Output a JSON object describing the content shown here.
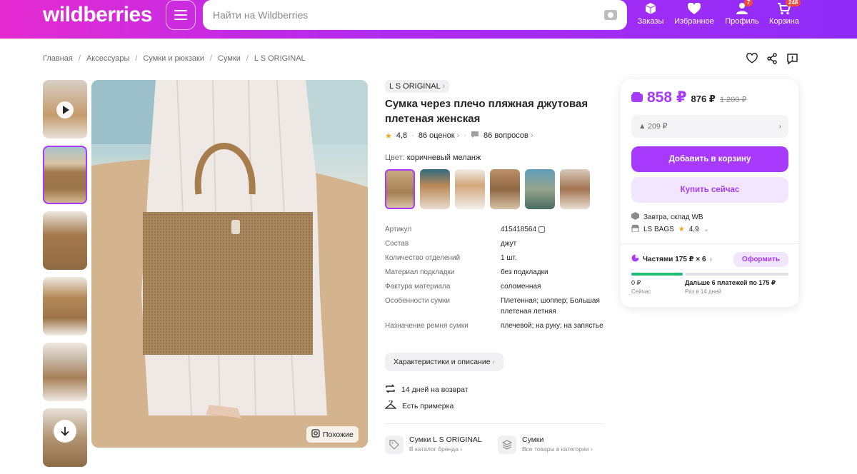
{
  "header": {
    "logo": "wildberries",
    "search_placeholder": "Найти на Wildberries",
    "nav": [
      {
        "label": "Заказы",
        "icon": "box-icon",
        "badge": ""
      },
      {
        "label": "Избранное",
        "icon": "heart-icon",
        "badge": ""
      },
      {
        "label": "Профиль",
        "icon": "user-icon",
        "badge": "7"
      },
      {
        "label": "Корзина",
        "icon": "cart-icon",
        "badge": "248"
      }
    ]
  },
  "breadcrumbs": [
    "Главная",
    "Аксессуары",
    "Сумки и рюкзаки",
    "Сумки",
    "L S ORIGINAL"
  ],
  "product": {
    "brand": "L S ORIGINAL",
    "title": "Сумка через плечо пляжная джутовая плетеная женская",
    "rating": "4,8",
    "reviews": "86 оценок",
    "questions": "86 вопросов",
    "color_label": "Цвет:",
    "color_value": "коричневый меланж",
    "similar_label": "Похожие",
    "properties": [
      {
        "key": "Артикул",
        "value": "415418564"
      },
      {
        "key": "Состав",
        "value": "джут"
      },
      {
        "key": "Количество отделений",
        "value": "1 шт."
      },
      {
        "key": "Материал подкладки",
        "value": "без подкладки"
      },
      {
        "key": "Фактура материала",
        "value": "соломенная"
      },
      {
        "key": "Особенности сумки",
        "value": "Плетенная; шоппер; Большая плетеная летняя"
      },
      {
        "key": "Назначение ремня сумки",
        "value": "плечевой; на руку; на запястье"
      }
    ],
    "desc_button": "Характеристики и описание",
    "features": [
      "14 дней на возврат",
      "Есть примерка"
    ],
    "links": [
      {
        "title": "Сумки L S ORIGINAL",
        "sub": "В каталог бренда"
      },
      {
        "title": "Сумки",
        "sub": "Все товары в категории"
      }
    ]
  },
  "buy": {
    "price": "858 ₽",
    "price_mid": "876 ₽",
    "price_old": "1 200 ₽",
    "wallet_discount": "▲ 209 ₽",
    "add_to_cart": "Добавить в корзину",
    "buy_now": "Купить сейчас",
    "delivery": "Завтра, склад WB",
    "seller": "LS BAGS",
    "seller_rating": "4,9",
    "installments": "Частями 175 ₽ × 6",
    "installments_btn": "Оформить",
    "now_amount": "0 ₽",
    "now_label": "Сейчас",
    "later_amount": "Дальше 6 платежей по 175 ₽",
    "later_label": "Раз в 14 дней"
  },
  "colors": {
    "accent": "#a73afd",
    "header_start": "#e52bd0",
    "header_end": "#8f2cf9",
    "install_bar": "#1fbf75"
  }
}
